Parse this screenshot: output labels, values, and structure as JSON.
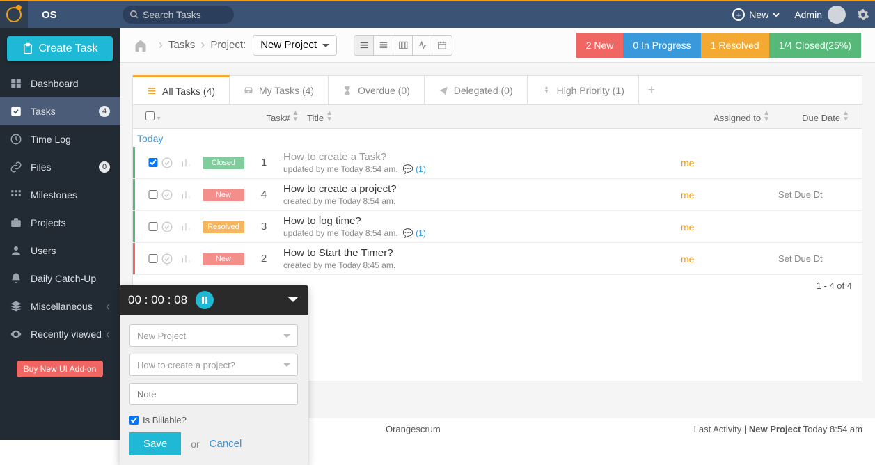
{
  "app": {
    "name": "OS",
    "search_placeholder": "Search Tasks",
    "new_label": "New",
    "admin_label": "Admin"
  },
  "sidebar": {
    "create_label": "Create Task",
    "items": [
      {
        "label": "Dashboard"
      },
      {
        "label": "Tasks",
        "badge": "4"
      },
      {
        "label": "Time Log"
      },
      {
        "label": "Files",
        "badge": "0"
      },
      {
        "label": "Milestones"
      },
      {
        "label": "Projects"
      },
      {
        "label": "Users"
      },
      {
        "label": "Daily Catch-Up"
      },
      {
        "label": "Miscellaneous"
      },
      {
        "label": "Recently viewed"
      }
    ],
    "buy_label": "Buy New UI Add-on"
  },
  "breadcrumb": {
    "tasks": "Tasks",
    "project_label": "Project:",
    "project_name": "New Project"
  },
  "status": {
    "new": "2 New",
    "progress": "0 In Progress",
    "resolved": "1 Resolved",
    "closed": "1/4 Closed(25%)"
  },
  "tabs": {
    "all": "All Tasks (4)",
    "my": "My Tasks (4)",
    "over": "Overdue (0)",
    "del": "Delegated (0)",
    "hp": "High Priority (1)"
  },
  "columns": {
    "task": "Task#",
    "title": "Title",
    "assigned": "Assigned to",
    "due": "Due Date"
  },
  "group": "Today",
  "rows": [
    {
      "num": "1",
      "status": "Closed",
      "title": "How to create a Task?",
      "meta": "updated by me Today 8:54 am.",
      "comments": "(1)",
      "assignee": "me",
      "due": "",
      "checked": true,
      "strike": true,
      "bar": "green",
      "pill": "closed"
    },
    {
      "num": "4",
      "status": "New",
      "title": "How to create a project?",
      "meta": "created by me Today 8:54 am.",
      "assignee": "me",
      "due": "Set Due Dt",
      "bar": "green",
      "pill": "new"
    },
    {
      "num": "3",
      "status": "Resolved",
      "title": "How to log time?",
      "meta": "updated by me Today 8:54 am.",
      "comments": "(1)",
      "assignee": "me",
      "due": "",
      "bar": "green",
      "pill": "res"
    },
    {
      "num": "2",
      "status": "New",
      "title": "How to Start the Timer?",
      "meta": "created by me Today 8:45 am.",
      "assignee": "me",
      "due": "Set Due Dt",
      "bar": "red",
      "pill": "new"
    }
  ],
  "pager": "1 - 4 of 4",
  "timer": {
    "time": "00 : 00 : 08",
    "project": "New Project",
    "task": "How to create a project?",
    "note_ph": "Note",
    "billable": "Is Billable?",
    "save": "Save",
    "or": "or",
    "cancel": "Cancel"
  },
  "footer": {
    "brand": "Orangescrum",
    "activity_pre": "Last Activity | ",
    "activity_proj": "New Project",
    "activity_time": " Today 8:54 am"
  }
}
